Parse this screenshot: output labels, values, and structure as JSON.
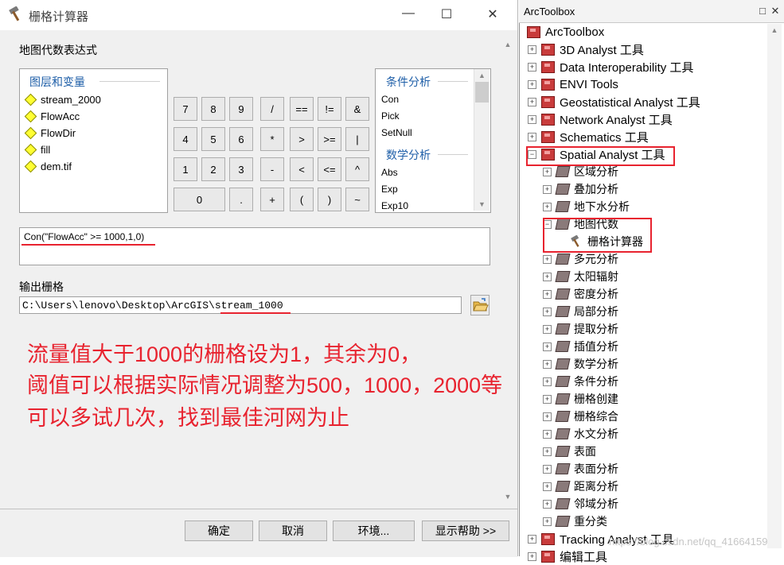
{
  "dialog": {
    "title": "栅格计算器",
    "window_controls": {
      "minimize": "—",
      "maximize": "☐",
      "close": "✕"
    },
    "section_title": "地图代数表达式",
    "layers_header": "图层和变量",
    "layers": [
      "stream_2000",
      "FlowAcc",
      "FlowDir",
      "fill",
      "dem.tif"
    ],
    "calculator": {
      "row1": [
        "7",
        "8",
        "9",
        "/",
        "==",
        "!=",
        "&"
      ],
      "row2": [
        "4",
        "5",
        "6",
        "*",
        ">",
        ">=",
        "|"
      ],
      "row3": [
        "1",
        "2",
        "3",
        "-",
        "<",
        "<=",
        "^"
      ],
      "row4": [
        "0",
        ".",
        "+",
        "(",
        ")",
        "~"
      ]
    },
    "functions": {
      "cond_header": "条件分析",
      "cond_items": [
        "Con",
        "Pick",
        "SetNull"
      ],
      "math_header": "数学分析",
      "math_items": [
        "Abs",
        "Exp",
        "Exp10"
      ]
    },
    "expression": "Con(\"FlowAcc\" >= 1000,1,0)",
    "output_label": "输出栅格",
    "output_path": "C:\\Users\\lenovo\\Desktop\\ArcGIS\\stream_1000",
    "annotation_lines": [
      "流量值大于1000的栅格设为1，其余为0，",
      "阈值可以根据实际情况调整为500，1000，2000等",
      "可以多试几次，找到最佳河网为止"
    ],
    "buttons": {
      "ok": "确定",
      "cancel": "取消",
      "env": "环境...",
      "help": "显示帮助 >>"
    }
  },
  "toolbox": {
    "title": "ArcToolbox",
    "controls": {
      "close": "✕",
      "pin": "□"
    },
    "root": "ArcToolbox",
    "toolboxes": [
      "3D Analyst 工具",
      "Data Interoperability 工具",
      "ENVI Tools",
      "Geostatistical Analyst 工具",
      "Network Analyst 工具",
      "Schematics 工具",
      "Spatial Analyst 工具"
    ],
    "spatial_children_before": [
      "区域分析",
      "叠加分析",
      "地下水分析"
    ],
    "map_algebra": "地图代数",
    "raster_calculator": "栅格计算器",
    "spatial_children_after": [
      "多元分析",
      "太阳辐射",
      "密度分析",
      "局部分析",
      "提取分析",
      "插值分析",
      "数学分析",
      "条件分析",
      "栅格创建",
      "栅格综合",
      "水文分析",
      "表面",
      "表面分析",
      "距离分析",
      "邻域分析",
      "重分类"
    ],
    "after_toolboxes": [
      "Tracking Analyst 工具",
      "编辑工具"
    ],
    "watermark": "https://blog.csdn.net/qq_41664159"
  },
  "colors": {
    "annotation": "#e8232f",
    "header_blue": "#1f5fa8",
    "toolbox_red": "#c83b3b"
  },
  "icons": [
    "hammer-icon",
    "diamond-layer-icon",
    "folder-open-icon",
    "toolbox-icon",
    "toolset-icon"
  ]
}
